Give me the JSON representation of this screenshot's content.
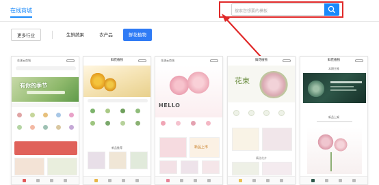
{
  "header": {
    "nav_label": "在线商城",
    "search": {
      "placeholder": "搜索您想要的模板"
    }
  },
  "tabs": [
    {
      "label": "更多行业",
      "active": false
    },
    {
      "label": "生鲜蔬果",
      "active": false
    },
    {
      "label": "农产品",
      "active": false
    },
    {
      "label": "鲜花植物",
      "active": true
    }
  ],
  "colors": {
    "accent": "#2f7bf5",
    "nav": "#1989fa",
    "highlight": "#e02828"
  },
  "templates": [
    {
      "title": "",
      "top_left": "花漾云商城",
      "banner_text": "有你的季节",
      "section": "",
      "hero": "",
      "promo": ""
    },
    {
      "title": "鲜花植物",
      "top_left": "",
      "banner_text": "",
      "section": "新品推荐",
      "hero": "",
      "promo": ""
    },
    {
      "title": "",
      "top_left": "花漾云商城",
      "banner_text": "",
      "section": "",
      "hero": "HELLO",
      "promo": "新品上市"
    },
    {
      "title": "鲜花植物",
      "top_left": "",
      "banner_text": "花束",
      "section": "精选花卉",
      "hero": "",
      "promo": ""
    },
    {
      "title": "鲜花植物",
      "top_left": "",
      "banner_text": "本期主推",
      "section": "新品上架",
      "hero": "",
      "promo": ""
    }
  ]
}
